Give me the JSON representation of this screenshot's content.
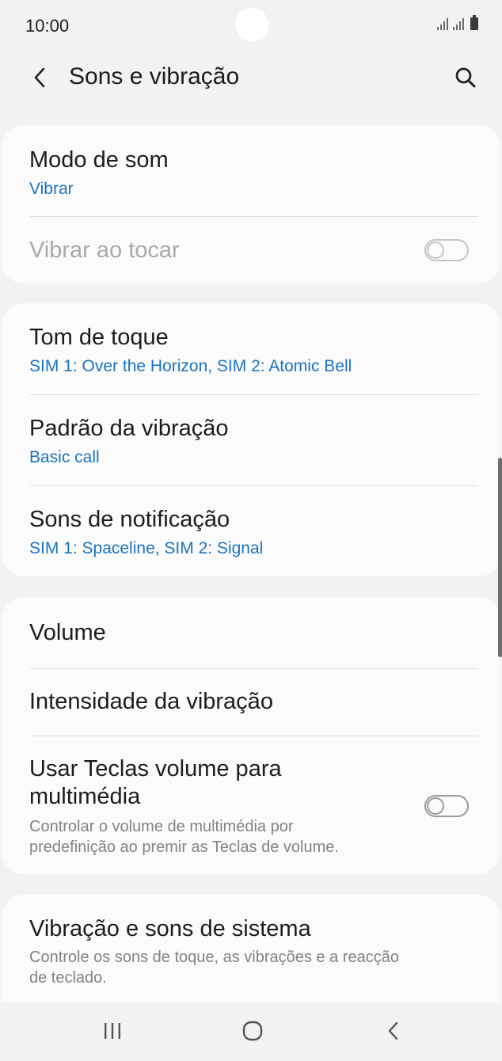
{
  "status": {
    "time": "10:00"
  },
  "header": {
    "title": "Sons e vibração",
    "back_icon": "chevron-left-icon",
    "search_icon": "search-icon"
  },
  "group1": {
    "modo_de_som": {
      "title": "Modo de som",
      "value": "Vibrar"
    },
    "vibrar_ao_tocar": {
      "title": "Vibrar ao tocar",
      "enabled": false,
      "on": false
    }
  },
  "group2": {
    "tom_de_toque": {
      "title": "Tom de toque",
      "value": "SIM 1: Over the Horizon, SIM 2: Atomic Bell"
    },
    "padrao_vibracao": {
      "title": "Padrão da vibração",
      "value": "Basic call"
    },
    "sons_notificacao": {
      "title": "Sons de notificação",
      "value": "SIM 1: Spaceline, SIM 2: Signal"
    }
  },
  "group3": {
    "volume": {
      "title": "Volume"
    },
    "intensidade": {
      "title": "Intensidade da vibração"
    },
    "teclas_volume": {
      "title_line1": "Usar Teclas volume para",
      "title_line2": "multimédia",
      "desc_line1": "Controlar o volume de multimédia por",
      "desc_line2": "predefinição ao premir as Teclas de volume.",
      "on": false
    }
  },
  "group4": {
    "sistema": {
      "title": "Vibração e sons de sistema",
      "desc_line1": "Controle os sons de toque, as vibrações e a reacção",
      "desc_line2": "de teclado."
    }
  },
  "nav": {
    "recents_icon": "recents-icon",
    "home_icon": "home-icon",
    "back_icon": "back-icon"
  },
  "colors": {
    "accent": "#1a73c4",
    "background": "#f2f2f2",
    "card": "#fbfbfb"
  }
}
